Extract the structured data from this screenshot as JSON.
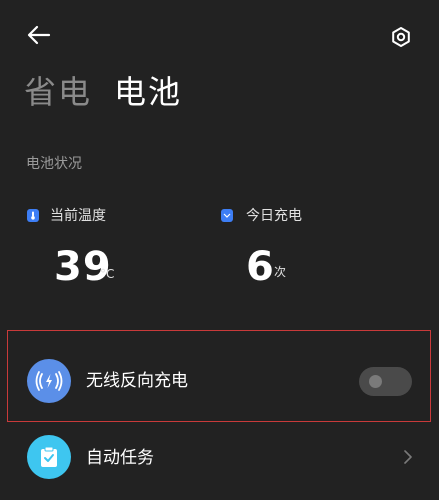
{
  "tabs": [
    {
      "label": "省电",
      "active": false
    },
    {
      "label": "电池",
      "active": true
    }
  ],
  "battery_status": {
    "section_label": "电池状况",
    "temperature": {
      "label": "当前温度",
      "value": "39",
      "unit": "°C"
    },
    "charge_count": {
      "label": "今日充电",
      "value": "6",
      "unit": "次"
    }
  },
  "rows": [
    {
      "label": "无线反向充电",
      "icon": "wireless-charging-icon",
      "control": "toggle",
      "toggle_on": false
    },
    {
      "label": "自动任务",
      "icon": "clipboard-check-icon",
      "control": "chevron"
    }
  ],
  "colors": {
    "background": "#222222",
    "accent_blue": "#3d7ef5",
    "wireless_icon_bg": "#5b8fe8",
    "task_icon_bg": "#3ec6f0",
    "highlight_border": "#c93a3a"
  }
}
